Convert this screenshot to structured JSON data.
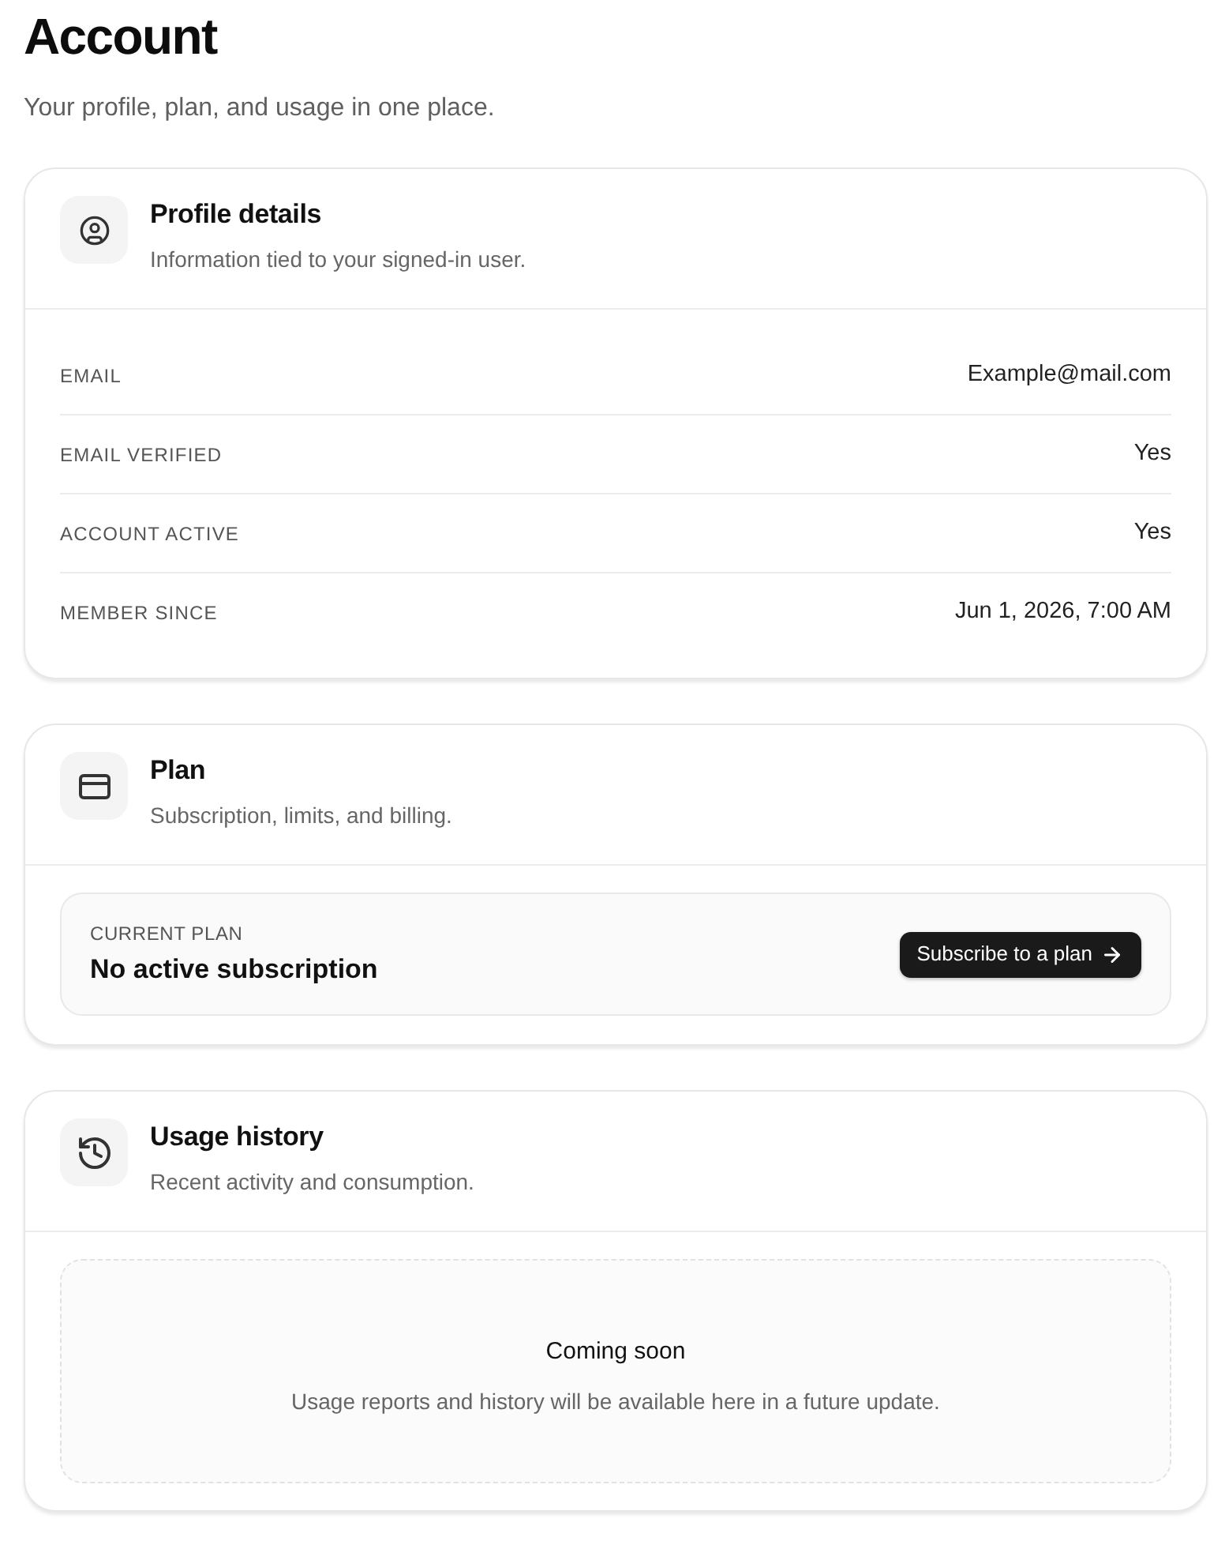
{
  "page": {
    "title": "Account",
    "subtitle": "Your profile, plan, and usage in one place."
  },
  "sections": [
    {
      "kind": "details",
      "title": "Profile details",
      "description": "Information tied to your signed-in user.",
      "fields": [
        {
          "label": "EMAIL",
          "value": "Example@mail.com"
        },
        {
          "label": "EMAIL VERIFIED",
          "value": "Yes"
        },
        {
          "label": "ACCOUNT ACTIVE",
          "value": "Yes"
        },
        {
          "label": "MEMBER SINCE",
          "value": "Jun 1, 2026, 7:00 AM"
        }
      ]
    },
    {
      "kind": "plan",
      "title": "Plan",
      "description": "Subscription, limits, and billing.",
      "current_plan": {
        "label": "CURRENT PLAN",
        "value": "No active subscription"
      },
      "button": {
        "label": "Subscribe to a plan"
      }
    },
    {
      "kind": "usage",
      "title": "Usage history",
      "description": "Recent activity and consumption.",
      "empty_state": {
        "title": "Coming soon",
        "message": "Usage reports and history will be available here in a future update."
      }
    }
  ]
}
